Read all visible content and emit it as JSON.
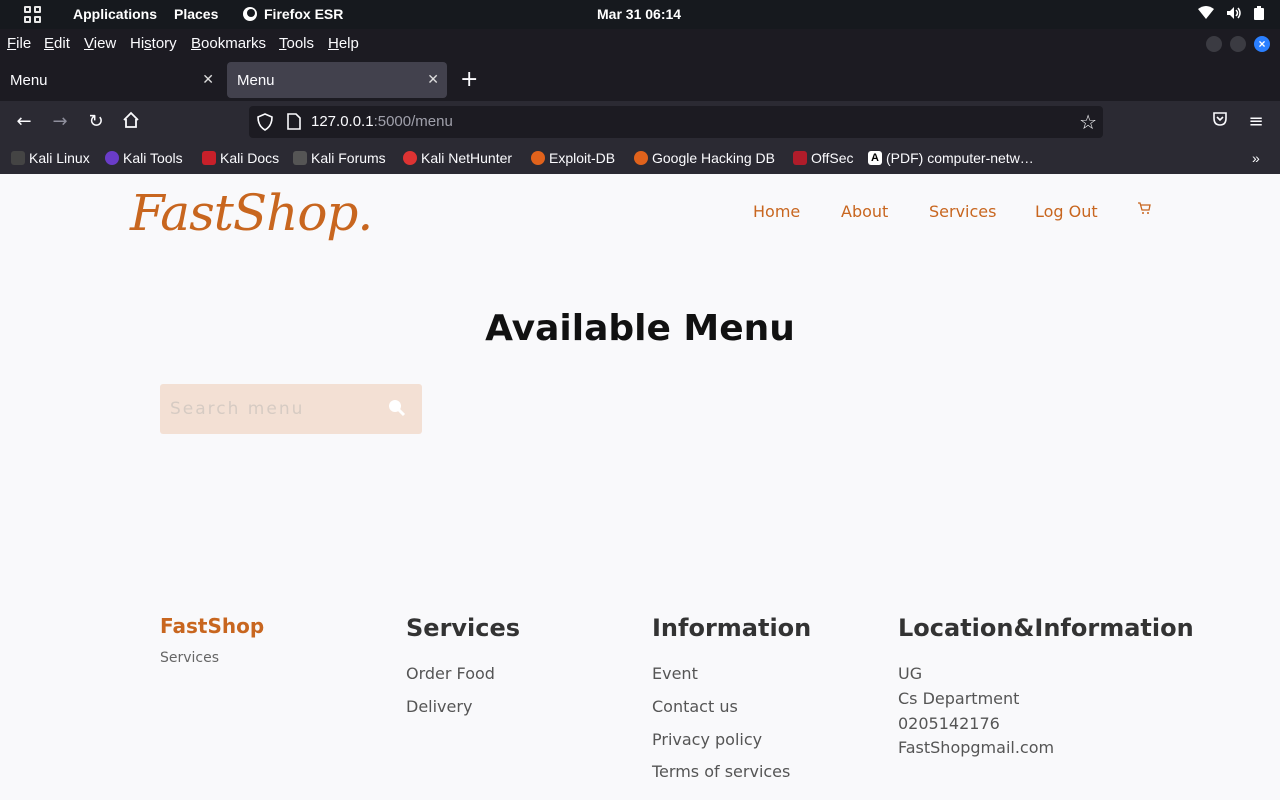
{
  "os_bar": {
    "applications": "Applications",
    "places": "Places",
    "firefox": "Firefox ESR",
    "clock": "Mar 31  06:14"
  },
  "firefox": {
    "menu": [
      "File",
      "Edit",
      "View",
      "History",
      "Bookmarks",
      "Tools",
      "Help"
    ],
    "tabs": [
      {
        "label": "Menu"
      },
      {
        "label": "Menu"
      }
    ],
    "url": {
      "host": "127.0.0.1",
      "path": ":5000/menu"
    },
    "bookmarks": [
      "Kali Linux",
      "Kali Tools",
      "Kali Docs",
      "Kali Forums",
      "Kali NetHunter",
      "Exploit-DB",
      "Google Hacking DB",
      "OffSec",
      "(PDF) computer-netw…"
    ]
  },
  "site": {
    "logo": "FastShop.",
    "nav": [
      "Home",
      "About",
      "Services",
      "Log Out"
    ],
    "heading": "Available Menu",
    "search_placeholder": "Search menu",
    "footer": {
      "brand": "FastShop",
      "brand_sub": "Services",
      "services_title": "Services",
      "services": [
        "Order Food",
        "Delivery"
      ],
      "info_title": "Information",
      "info": [
        "Event",
        "Contact us",
        "Privacy policy",
        "Terms of services"
      ],
      "location_title": "Location&Information",
      "location": [
        "UG",
        "Cs Department",
        "0205142176",
        "FastShopgmail.com"
      ]
    }
  },
  "colors": {
    "accent": "#c8661f",
    "search_bg": "#f3e0d4"
  }
}
